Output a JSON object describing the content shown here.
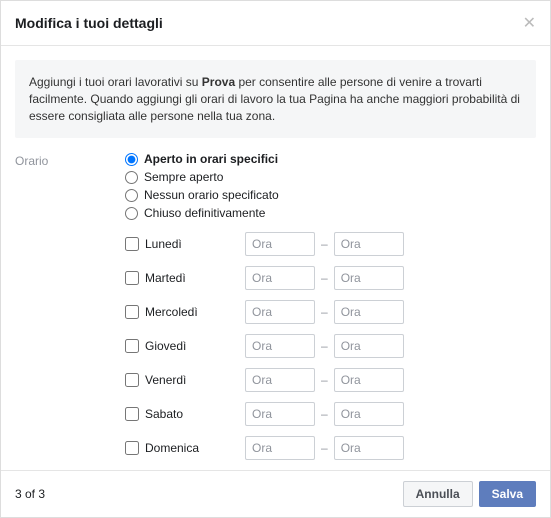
{
  "header": {
    "title": "Modifica i tuoi dettagli"
  },
  "info": {
    "prefix": "Aggiungi i tuoi orari lavorativi su ",
    "bold": "Prova",
    "suffix": " per consentire alle persone di venire a trovarti facilmente. Quando aggiungi gli orari di lavoro la tua Pagina ha anche maggiori probabilità di essere consigliata alle persone nella tua zona."
  },
  "form": {
    "label": "Orario",
    "options": {
      "specific": "Aperto in orari specifici",
      "always": "Sempre aperto",
      "none": "Nessun orario specificato",
      "closed": "Chiuso definitivamente",
      "selected": "specific"
    },
    "time_placeholder": "Ora",
    "days": [
      {
        "label": "Lunedì"
      },
      {
        "label": "Martedì"
      },
      {
        "label": "Mercoledì"
      },
      {
        "label": "Giovedì"
      },
      {
        "label": "Venerdì"
      },
      {
        "label": "Sabato"
      },
      {
        "label": "Domenica"
      }
    ]
  },
  "footer": {
    "step": "3 of 3",
    "cancel": "Annulla",
    "save": "Salva"
  }
}
